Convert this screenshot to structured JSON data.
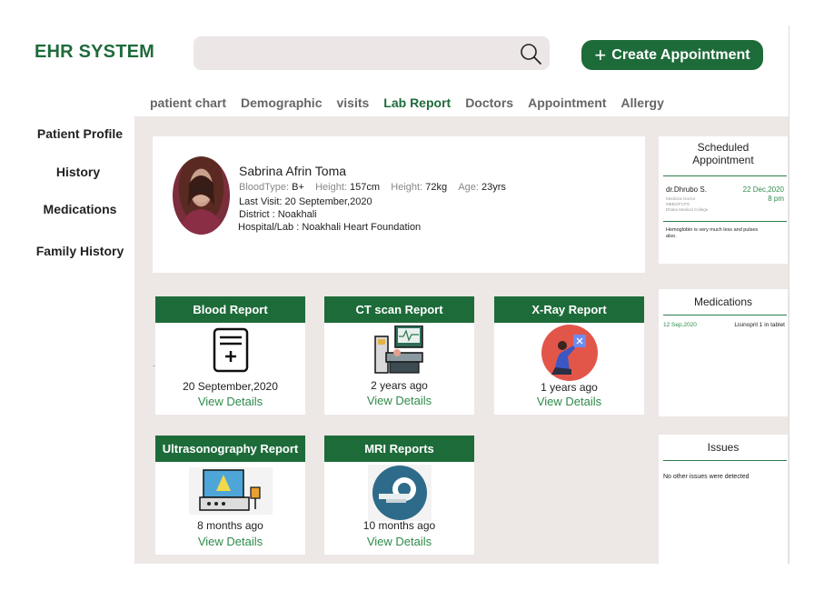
{
  "app": {
    "logo": "EHR SYSTEM"
  },
  "header": {
    "create_button": "Create Appointment"
  },
  "tabs": [
    "patient chart",
    "Demographic",
    "visits",
    "Lab Report",
    "Doctors",
    "Appointment",
    "Allergy"
  ],
  "active_tab": "Lab Report",
  "sidebar": {
    "items": [
      "Patient Profile",
      "History",
      "Medications",
      "Family History"
    ]
  },
  "patient": {
    "name": "Sabrina Afrin Toma",
    "blood_type_label": "BloodType:",
    "blood_type": "B+",
    "height_label": "Height:",
    "height": "157cm",
    "weight_label": "Height:",
    "weight": "72kg",
    "age_label": "Age:",
    "age": "23yrs",
    "last_visit": "Last Visit:  20 September,2020",
    "district": "District : Noakhali",
    "hospital": "Hospital/Lab : Noakhali Heart Foundation"
  },
  "scheduled": {
    "title": "Scheduled Appointment",
    "doctor": "dr.Dhrubo S.",
    "date": "22 Dec,2020",
    "time": "8 pm",
    "sub1": "Medicine Doctor",
    "sub2": "MBBS/FCPS",
    "sub3": "Dhaka Medical College",
    "note": "Hemoglobin is very much less and pulses also."
  },
  "medications": {
    "title": "Medications",
    "date": "12 Sep,2020",
    "entry": "Lisinopril 1 in tablet"
  },
  "issues": {
    "title": "Issues",
    "text": "No other issues were detected"
  },
  "reports": [
    {
      "title": "Blood Report",
      "time": "20 September,2020",
      "link": "View Details",
      "icon": "blood-report-icon"
    },
    {
      "title": "CT scan Report",
      "time": "2 years ago",
      "link": "View Details",
      "icon": "ct-scan-icon"
    },
    {
      "title": "X-Ray Report",
      "time": "1 years ago",
      "link": "View Details",
      "icon": "xray-icon"
    },
    {
      "title": "Ultrasonography Report",
      "time": "8 months ago",
      "link": "View Details",
      "icon": "ultrasound-icon"
    },
    {
      "title": "MRI Reports",
      "time": "10 months ago",
      "link": "View Details",
      "icon": "mri-icon"
    }
  ],
  "colors": {
    "brand": "#1e6b3a",
    "link": "#2e8b4a",
    "panel_bg": "#ede7e6"
  }
}
